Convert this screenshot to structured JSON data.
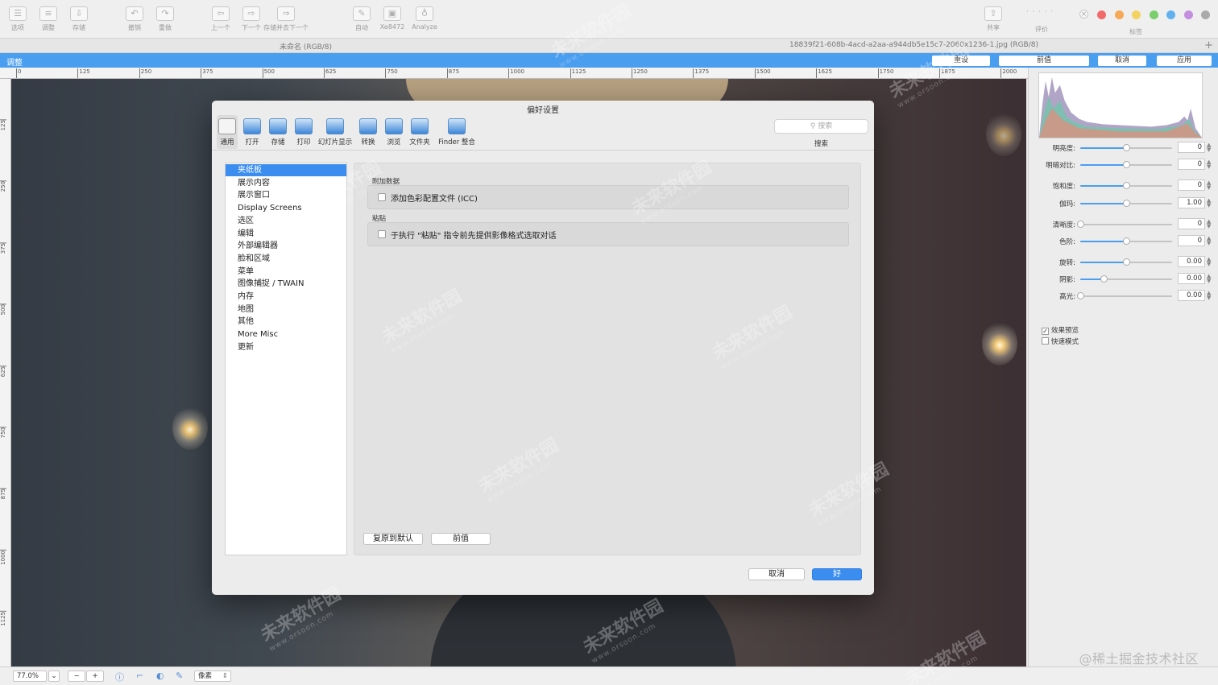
{
  "toolbar": {
    "left": [
      {
        "label": "选项",
        "icon": "options-icon"
      },
      {
        "label": "调整",
        "icon": "adjust-icon"
      },
      {
        "label": "存储",
        "icon": "save-icon"
      },
      {
        "label": "撤销",
        "icon": "undo-icon"
      },
      {
        "label": "重做",
        "icon": "redo-icon"
      },
      {
        "label": "上一个",
        "icon": "previous-icon"
      },
      {
        "label": "下一个",
        "icon": "next-icon"
      },
      {
        "label": "存储并去下一个",
        "icon": "save-next-icon"
      },
      {
        "label": "自动",
        "icon": "auto-icon"
      },
      {
        "label": "Xe8472",
        "icon": "image-icon"
      },
      {
        "label": "Analyze",
        "icon": "analyze-icon"
      }
    ],
    "share_label": "共享",
    "rating_label": "评价",
    "tags_label": "标签",
    "tag_colors": [
      "#f26b6b",
      "#f5a855",
      "#f2d261",
      "#79cf6b",
      "#62b1ef",
      "#c38ee0",
      "#aaaaaa"
    ]
  },
  "titles": {
    "left": "未命名 (RGB/8)",
    "right": "18839f21-608b-4acd-a2aa-a944db5e15c7-2060x1236-1.jpg (RGB/8)"
  },
  "adjust_bar": {
    "label": "调整",
    "buttons": [
      "重设",
      "前值",
      "取消",
      "应用"
    ]
  },
  "ruler": {
    "h": [
      "0",
      "125",
      "250",
      "375",
      "500",
      "625",
      "750",
      "875",
      "1000",
      "1125",
      "1250",
      "1375",
      "1500",
      "1625",
      "1750",
      "1875",
      "2000"
    ],
    "v": [
      "125",
      "250",
      "375",
      "500",
      "625",
      "750",
      "875",
      "1000",
      "1125"
    ]
  },
  "adjust_panel": {
    "sliders": [
      {
        "label": "明亮度:",
        "value": "0",
        "level": 0.5
      },
      {
        "label": "明暗对比:",
        "value": "0",
        "level": 0.5
      },
      {
        "label": "饱和度:",
        "value": "0",
        "level": 0.5
      },
      {
        "label": "伽玛:",
        "value": "1.00",
        "level": 0.5
      },
      {
        "label": "清晰度:",
        "value": "0",
        "level": 0.0
      },
      {
        "label": "色阶:",
        "value": "0",
        "level": 0.5
      },
      {
        "label": "旋转:",
        "value": "0.00",
        "level": 0.5
      },
      {
        "label": "阴影:",
        "value": "0.00",
        "level": 0.25
      },
      {
        "label": "高光:",
        "value": "0.00",
        "level": 0.0
      }
    ],
    "preview_label": "效果预览",
    "preview_checked": true,
    "fast_label": "快速模式",
    "fast_checked": false
  },
  "status": {
    "zoom": "77.0%",
    "unit": "像素"
  },
  "credit": "@稀土掘金技术社区",
  "dialog": {
    "title": "偏好设置",
    "tabs": [
      "通用",
      "打开",
      "存储",
      "打印",
      "幻灯片显示",
      "转换",
      "浏览",
      "文件夹",
      "Finder 整合"
    ],
    "search_placeholder": "搜索",
    "search_label": "搜索",
    "categories": [
      "夹纸板",
      "展示内容",
      "展示窗口",
      "Display Screens",
      "选区",
      "编辑",
      "外部编辑器",
      "脸和区域",
      "菜单",
      "图像捕捉 / TWAIN",
      "内存",
      "地图",
      "其他",
      "More Misc",
      "更新"
    ],
    "selected_category": 0,
    "section1": {
      "heading": "附加数据",
      "checkbox": "添加色彩配置文件 (ICC)"
    },
    "section2": {
      "heading": "粘贴",
      "checkbox": "于执行 \"粘贴\" 指令前先提供影像格式选取对话"
    },
    "restore_btn": "复原到默认",
    "previous_btn": "前值",
    "cancel_btn": "取消",
    "ok_btn": "好"
  },
  "watermark": {
    "text": "未来软件园",
    "url": "www.orsoon.com"
  }
}
